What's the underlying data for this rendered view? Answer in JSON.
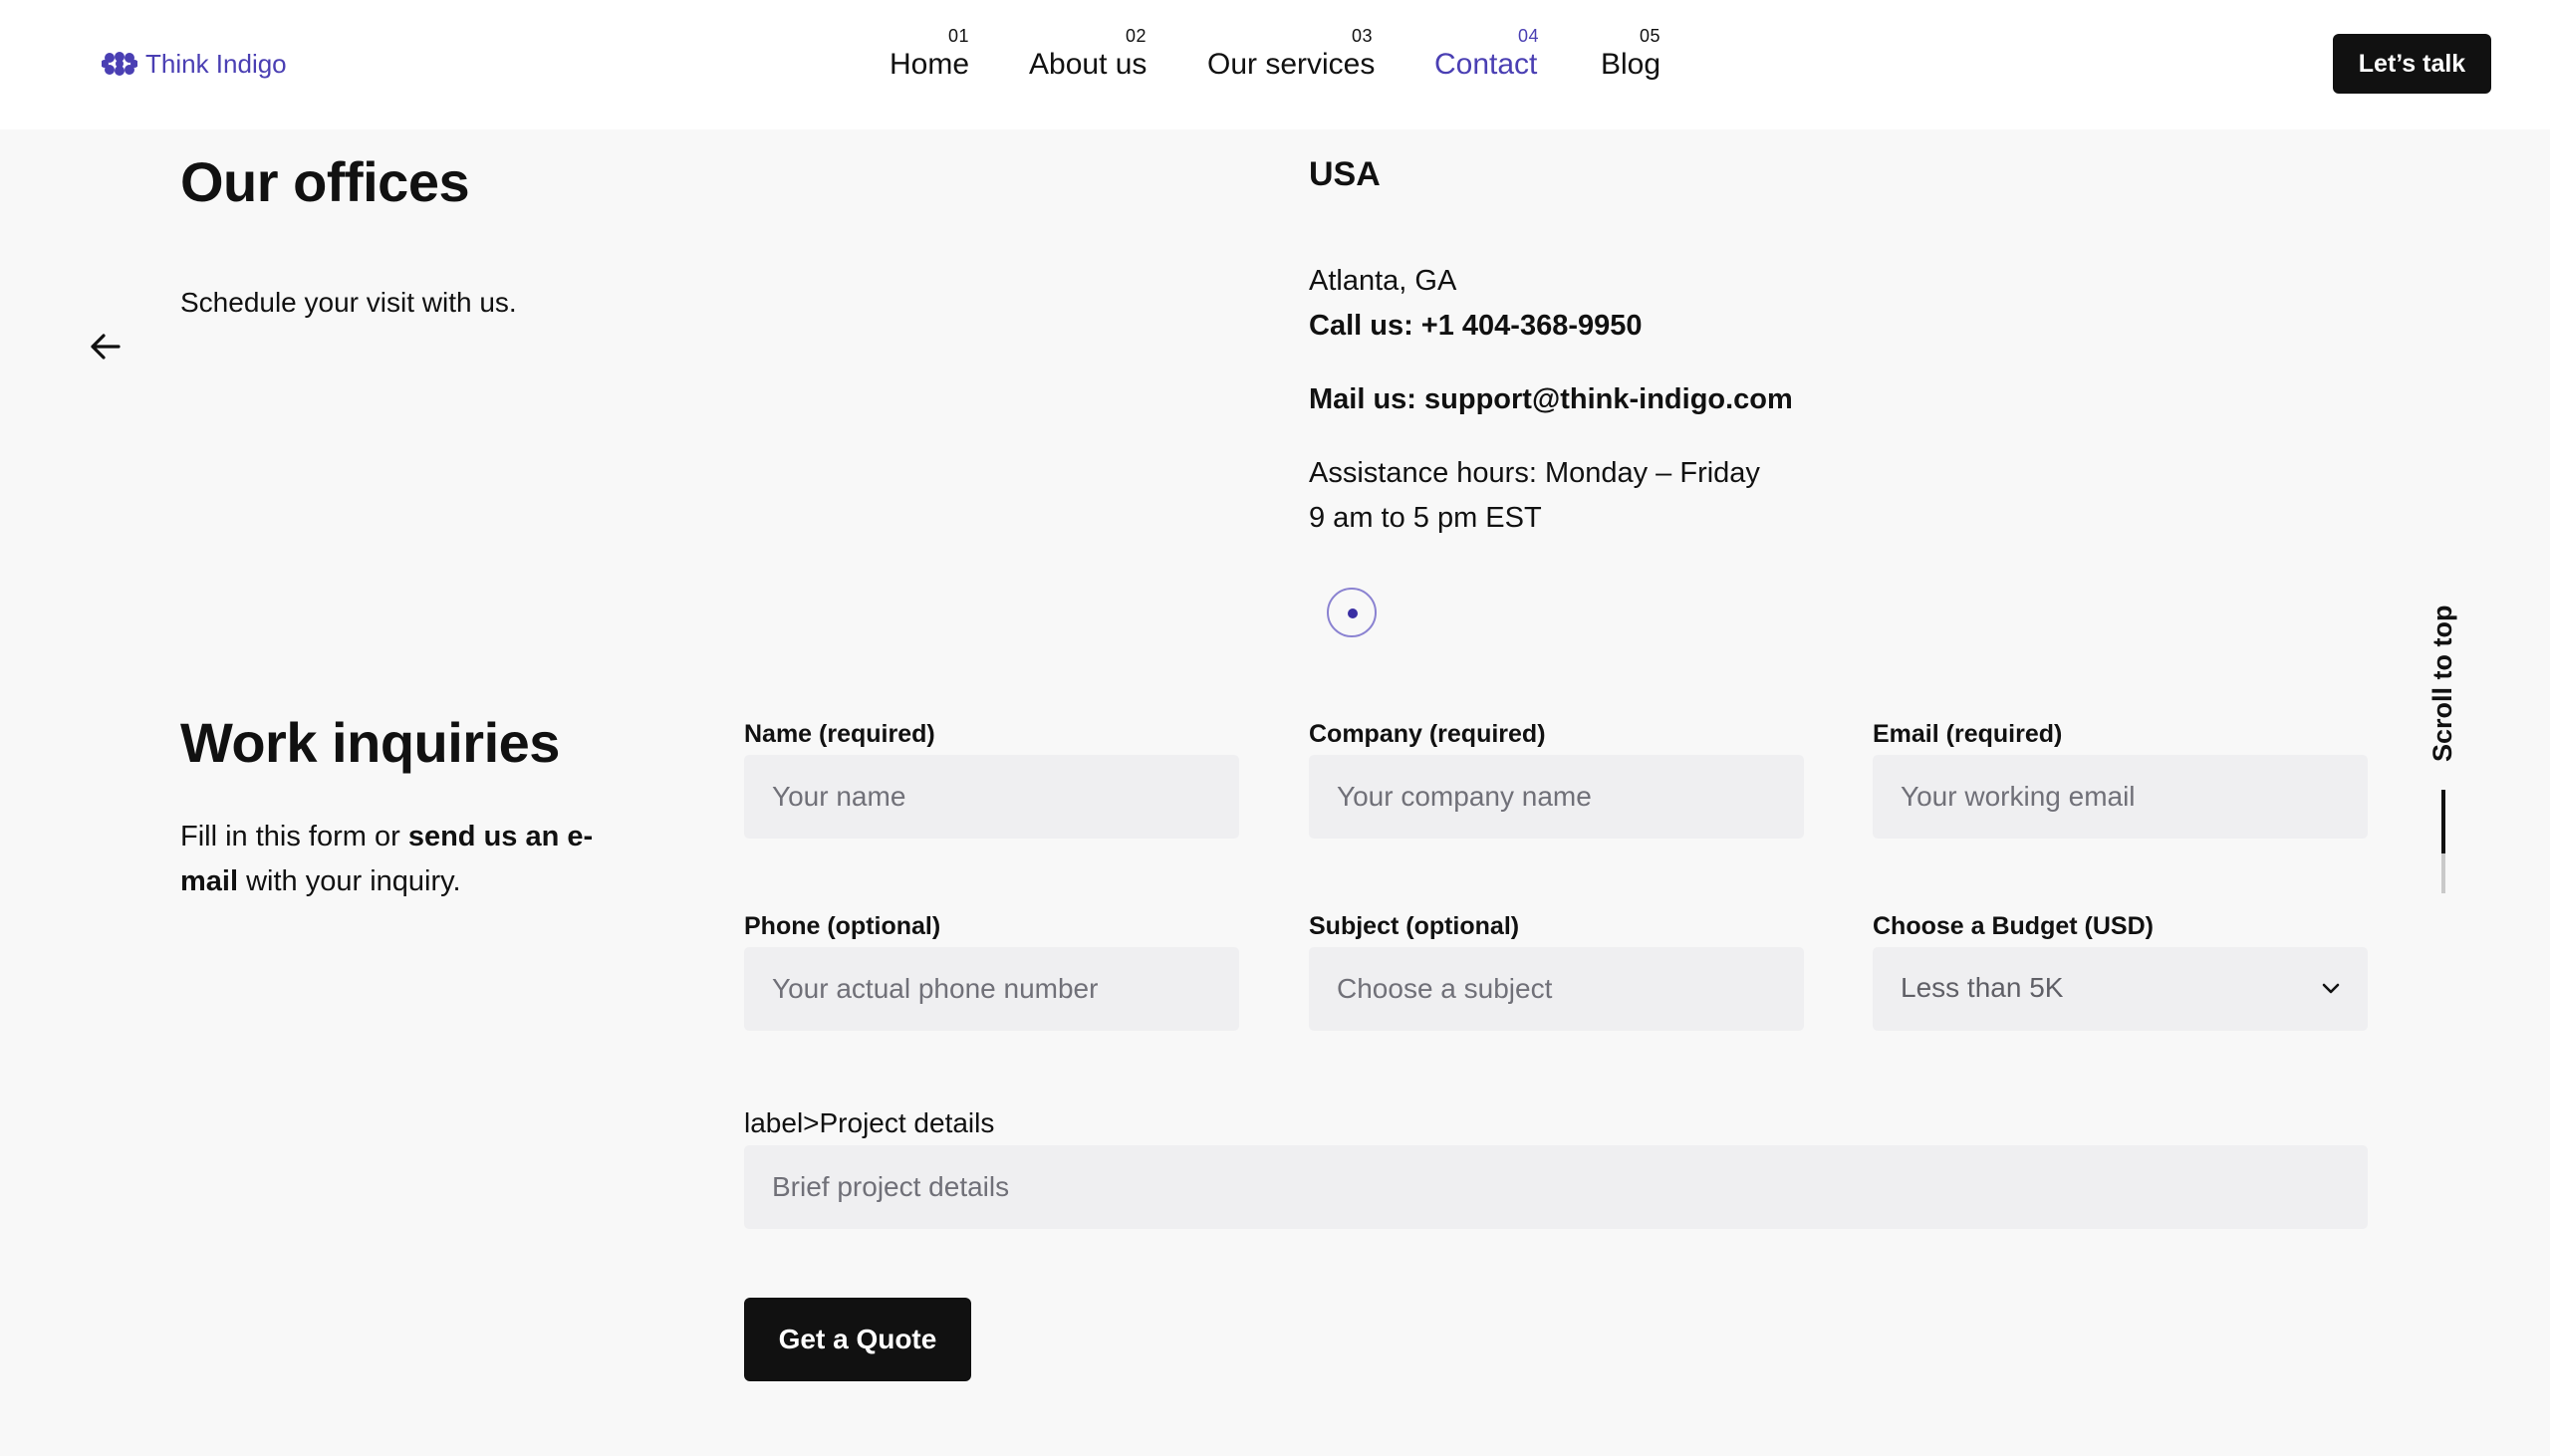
{
  "brand": {
    "name": "Think Indigo",
    "color": "#4a3fb3",
    "icon": "flower-logo-icon"
  },
  "nav": {
    "items": [
      {
        "num": "01",
        "label": "Home",
        "active": false
      },
      {
        "num": "02",
        "label": "About us",
        "active": false
      },
      {
        "num": "03",
        "label": "Our services",
        "active": false
      },
      {
        "num": "04",
        "label": "Contact",
        "active": true
      },
      {
        "num": "05",
        "label": "Blog",
        "active": false
      }
    ],
    "cta": "Let’s talk"
  },
  "offices": {
    "title": "Our offices",
    "subtitle": "Schedule your visit with us.",
    "back_icon": "arrow-left-icon",
    "country": "USA",
    "city": "Atlanta, GA",
    "call": "Call us: +1 404-368-9950",
    "mail": "Mail us: support@think-indigo.com",
    "hours_line1": "Assistance hours: Monday – Friday",
    "hours_line2": "9 am to 5 pm EST"
  },
  "scroll_top": {
    "label": "Scroll to top"
  },
  "inquiries": {
    "title": "Work inquiries",
    "sub_prefix": "Fill in this form or ",
    "sub_bold": "send us an e-mail",
    "sub_suffix": " with your inquiry.",
    "fields": {
      "name": {
        "label": "Name (required)",
        "placeholder": "Your name"
      },
      "company": {
        "label": "Company (required)",
        "placeholder": "Your company name"
      },
      "email": {
        "label": "Email (required)",
        "placeholder": "Your working email"
      },
      "phone": {
        "label": "Phone (optional)",
        "placeholder": "Your actual phone number"
      },
      "subject": {
        "label": "Subject (optional)",
        "placeholder": "Choose a subject"
      },
      "budget": {
        "label": "Choose a Budget (USD)",
        "value": "Less than 5K"
      }
    },
    "details": {
      "label": "label>Project details",
      "placeholder": "Brief project details"
    },
    "submit": "Get a Quote"
  }
}
